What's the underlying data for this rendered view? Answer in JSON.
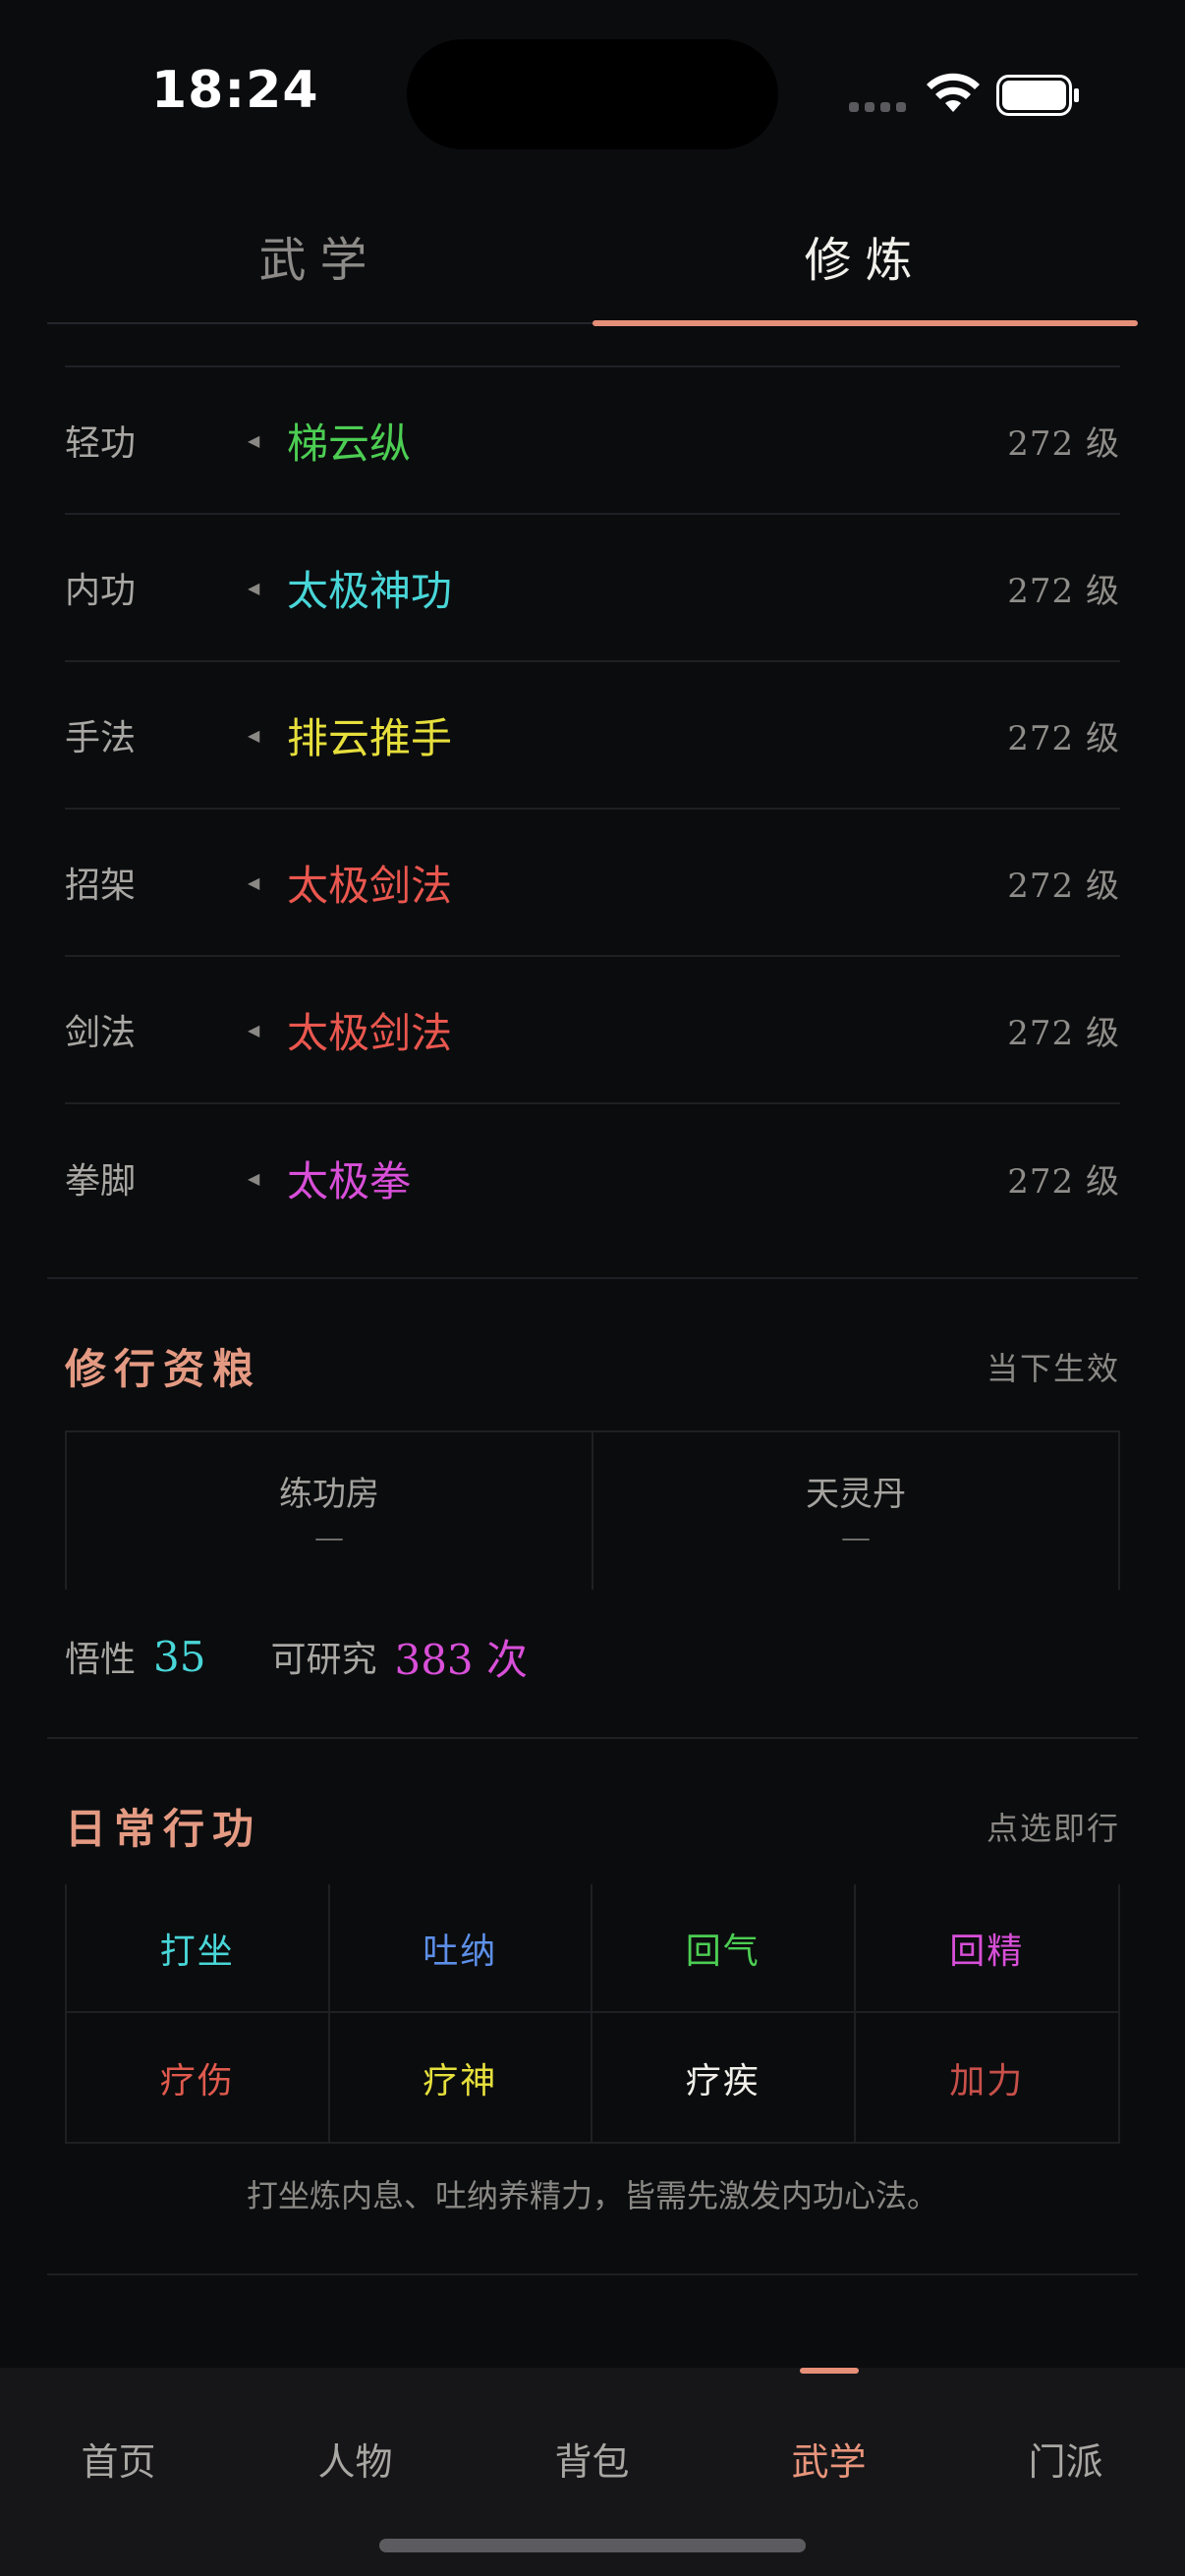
{
  "status_bar": {
    "time": "18:24"
  },
  "tabs": [
    {
      "label": "武学",
      "active": false
    },
    {
      "label": "修炼",
      "active": true
    }
  ],
  "skills": [
    {
      "slot": "轻功",
      "name": "梯云纵",
      "level": "272 级",
      "color": "#4ccd53"
    },
    {
      "slot": "内功",
      "name": "太极神功",
      "level": "272 级",
      "color": "#49d6d8"
    },
    {
      "slot": "手法",
      "name": "排云推手",
      "level": "272 级",
      "color": "#e6df3c"
    },
    {
      "slot": "招架",
      "name": "太极剑法",
      "level": "272 级",
      "color": "#e9574f"
    },
    {
      "slot": "剑法",
      "name": "太极剑法",
      "level": "272 级",
      "color": "#e9574f"
    },
    {
      "slot": "拳脚",
      "name": "太极拳",
      "level": "272 级",
      "color": "#d84fd8"
    }
  ],
  "resources": {
    "title": "修行资粮",
    "note": "当下生效",
    "items": [
      {
        "name": "练功房",
        "value": "—"
      },
      {
        "name": "天灵丹",
        "value": "—"
      }
    ],
    "stats": [
      {
        "label": "悟性",
        "value": "35",
        "color": "#49d6d8"
      },
      {
        "label": "可研究",
        "value": "383 次",
        "color": "#d84fd8"
      }
    ]
  },
  "daily": {
    "title": "日常行功",
    "note": "点选即行",
    "actions": [
      {
        "label": "打坐",
        "color": "#49d6d8"
      },
      {
        "label": "吐纳",
        "color": "#5d8fe8"
      },
      {
        "label": "回气",
        "color": "#4ccd53"
      },
      {
        "label": "回精",
        "color": "#d84fd8"
      },
      {
        "label": "疗伤",
        "color": "#e05a4e"
      },
      {
        "label": "疗神",
        "color": "#e6df3c"
      },
      {
        "label": "疗疾",
        "color": "#f1efea"
      },
      {
        "label": "加力",
        "color": "#c9504a"
      }
    ],
    "hint": "打坐炼内息、吐纳养精力，皆需先激发内功心法。"
  },
  "bottom_nav": [
    {
      "label": "首页",
      "active": false
    },
    {
      "label": "人物",
      "active": false
    },
    {
      "label": "背包",
      "active": false
    },
    {
      "label": "武学",
      "active": true
    },
    {
      "label": "门派",
      "active": false
    }
  ],
  "accent_color": "#e58f78"
}
